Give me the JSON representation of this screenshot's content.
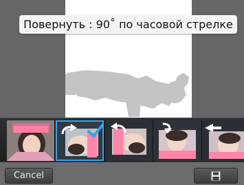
{
  "caption": "Повернуть : 90˚ по часовой стрелке",
  "buttons": {
    "cancel": "Cancel",
    "save_icon": "floppy-disk-icon"
  },
  "filmstrip": {
    "items": [
      {
        "name": "original"
      },
      {
        "name": "rotate-clockwise",
        "selected": true
      },
      {
        "name": "rotate-counterclockwise"
      },
      {
        "name": "rotate-180"
      },
      {
        "name": "flip-horizontal"
      }
    ]
  },
  "colors": {
    "selection": "#3aa0e6",
    "checkmark": "#3aa0e6"
  }
}
